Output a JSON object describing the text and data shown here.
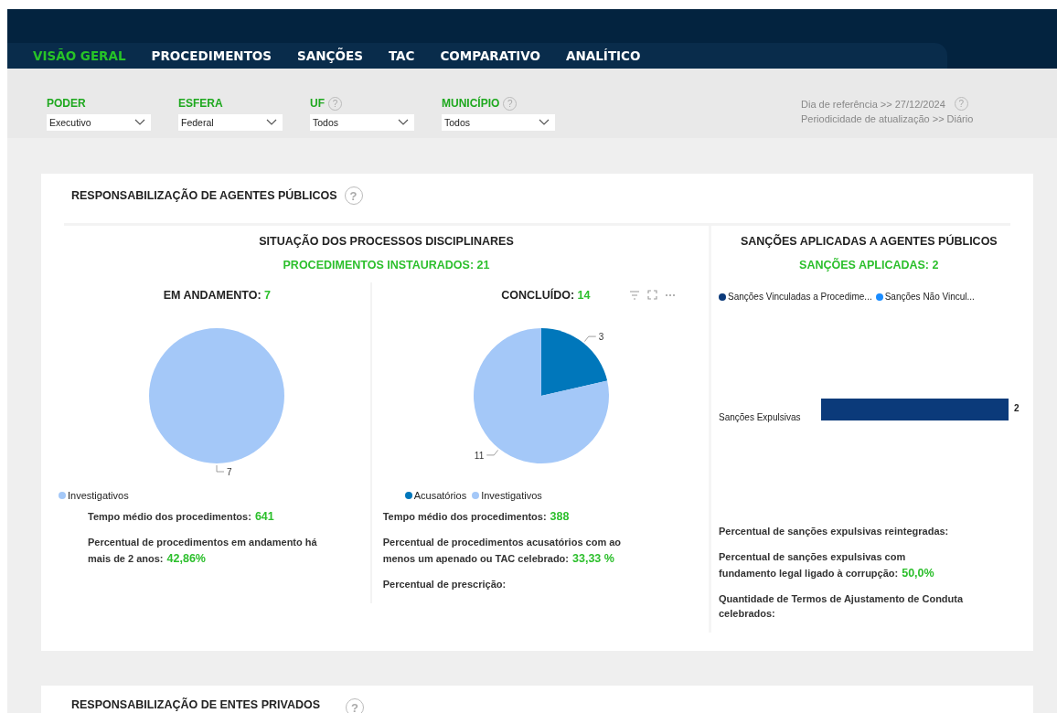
{
  "nav": {
    "tabs": [
      {
        "label": "VISÃO GERAL",
        "selected": true
      },
      {
        "label": "PROCEDIMENTOS",
        "selected": false
      },
      {
        "label": "SANÇÕES",
        "selected": false
      },
      {
        "label": "TAC",
        "selected": false
      },
      {
        "label": "COMPARATIVO",
        "selected": false
      },
      {
        "label": "ANALÍTICO",
        "selected": false
      }
    ]
  },
  "filters": [
    {
      "label": "PODER",
      "value": "Executivo"
    },
    {
      "label": "ESFERA",
      "value": "Federal"
    },
    {
      "label": "UF",
      "help": "?",
      "value": "Todos"
    },
    {
      "label": "MUNICÍPIO",
      "help": "?",
      "value": "Todos"
    }
  ],
  "reference": {
    "lines": [
      "Dia de referência >> 27/12/2024",
      "Periodicidade de atualização >> Diário"
    ],
    "help": "?"
  },
  "section": {
    "title": "RESPONSABILIZAÇÃO DE AGENTES PÚBLICOS",
    "help": "?",
    "processes": {
      "title": "SITUAÇÃO DOS PROCESSOS DISCIPLINARES",
      "total": "PROCEDIMENTOS INSTAURADOS: 21",
      "panels": [
        {
          "label": "EM ANDAMENTO:",
          "count": "7",
          "toolbar": false,
          "chart_data": {
            "type": "pie",
            "value_labels": [
              "7"
            ],
            "categories": [
              "Investigativos"
            ],
            "values": [
              7
            ]
          },
          "metrics": [
            {
              "label": "Tempo médio dos procedimentos:",
              "value": "641"
            },
            {
              "label": "Percentual de procedimentos em andamento há mais de 2 anos:",
              "value": "42,86%"
            }
          ]
        },
        {
          "label": "CONCLUÍDO:",
          "count": "14",
          "toolbar": true,
          "chart_data": {
            "type": "pie",
            "data_labels": true,
            "categories": [
              "Acusatórios",
              "Investigativos"
            ],
            "values": [
              3,
              11
            ]
          },
          "metrics": [
            {
              "label": "Tempo médio dos procedimentos:",
              "value": "388"
            },
            {
              "label": "Percentual de procedimentos acusatórios com ao menos um apenado ou TAC celebrado:",
              "value": "33,33 %"
            },
            {
              "label": "Percentual de prescrição:"
            }
          ]
        }
      ]
    },
    "sanctions": {
      "title": "SANÇÕES APLICADAS A AGENTES PÚBLICOS",
      "total": "SANÇÕES APLICADAS: 2",
      "chart_data": {
        "type": "bar",
        "orientation": "horizontal",
        "data_labels": true,
        "categories": [
          "Sanções Expulsivas"
        ],
        "series": [
          {
            "name": "Sanções Vinculadas a Procedime...",
            "color": "#0b3a7a",
            "values": [
              2
            ]
          },
          {
            "name": "Sanções Não Vincul...",
            "color": "#1a8cff",
            "values": [
              null
            ]
          }
        ]
      },
      "metrics": [
        {
          "label": "Percentual de sanções expulsivas reintegradas:"
        },
        {
          "label": "Percentual de sanções expulsivas com fundamento legal ligado à corrupção:",
          "value": "50,0%"
        },
        {
          "label": "Quantidade de Termos de Ajustamento de Conduta celebrados:"
        }
      ]
    }
  },
  "next_section": {
    "title": "RESPONSABILIZAÇÃO DE ENTES PRIVADOS",
    "help": "?"
  }
}
